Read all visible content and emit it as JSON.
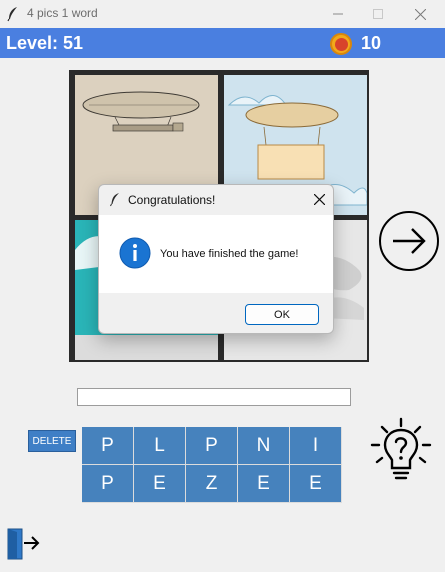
{
  "window": {
    "title": "4 pics 1 word",
    "app_icon": "feather-icon",
    "controls": [
      "minimize-icon",
      "maximize-icon",
      "close-icon"
    ]
  },
  "header": {
    "level_text": "Level: 51",
    "coin_icon": "coin-icon",
    "coins": "10"
  },
  "pictures": [
    {
      "icon": "airship-photo"
    },
    {
      "icon": "airship-banner-illustration"
    },
    {
      "icon": "airship-teal-photo"
    },
    {
      "icon": "airship-clouds-photo"
    }
  ],
  "next_icon": "arrow-right-circle-icon",
  "answer": {
    "value": ""
  },
  "delete_label": "DELETE",
  "letters": [
    [
      "P",
      "L",
      "P",
      "N",
      "I"
    ],
    [
      "P",
      "E",
      "Z",
      "E",
      "E"
    ]
  ],
  "hint_icon": "lightbulb-question-icon",
  "exit_icon": "exit-door-icon",
  "dialog": {
    "title": "Congratulations!",
    "message": "You have finished the game!",
    "ok_label": "OK",
    "info_icon": "info-icon"
  },
  "colors": {
    "header_bar": "#4a7fe0",
    "letter_tile": "#4682bd",
    "delete_button": "#3f7fc6",
    "dialog_accent": "#0067c0"
  }
}
